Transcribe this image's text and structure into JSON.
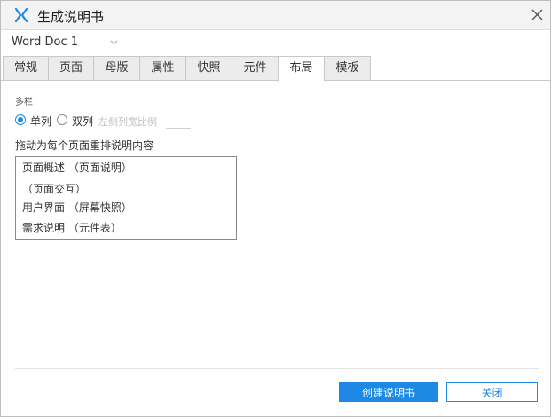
{
  "window": {
    "title": "生成说明书",
    "logo_icon": "axure-x-icon",
    "close_icon": "close-icon",
    "accent": "#1e88e5"
  },
  "doc_select": {
    "value": "Word Doc 1"
  },
  "tabs": [
    {
      "label": "常规",
      "active": false
    },
    {
      "label": "页面",
      "active": false
    },
    {
      "label": "母版",
      "active": false
    },
    {
      "label": "属性",
      "active": false
    },
    {
      "label": "快照",
      "active": false
    },
    {
      "label": "元件",
      "active": false
    },
    {
      "label": "布局",
      "active": true
    },
    {
      "label": "模板",
      "active": false
    }
  ],
  "layout": {
    "section_label": "多栏",
    "single_label": "单列",
    "double_label": "双列",
    "selected": "单列",
    "ratio_label": "左侧列宽比例",
    "ratio_value": "",
    "drag_label": "拖动为每个页面重排说明内容",
    "items": [
      "页面概述 （页面说明）",
      "（页面交互）",
      "用户界面 （屏幕快照）",
      "需求说明 （元件表）"
    ]
  },
  "footer": {
    "create_label": "创建说明书",
    "close_label": "关闭"
  }
}
